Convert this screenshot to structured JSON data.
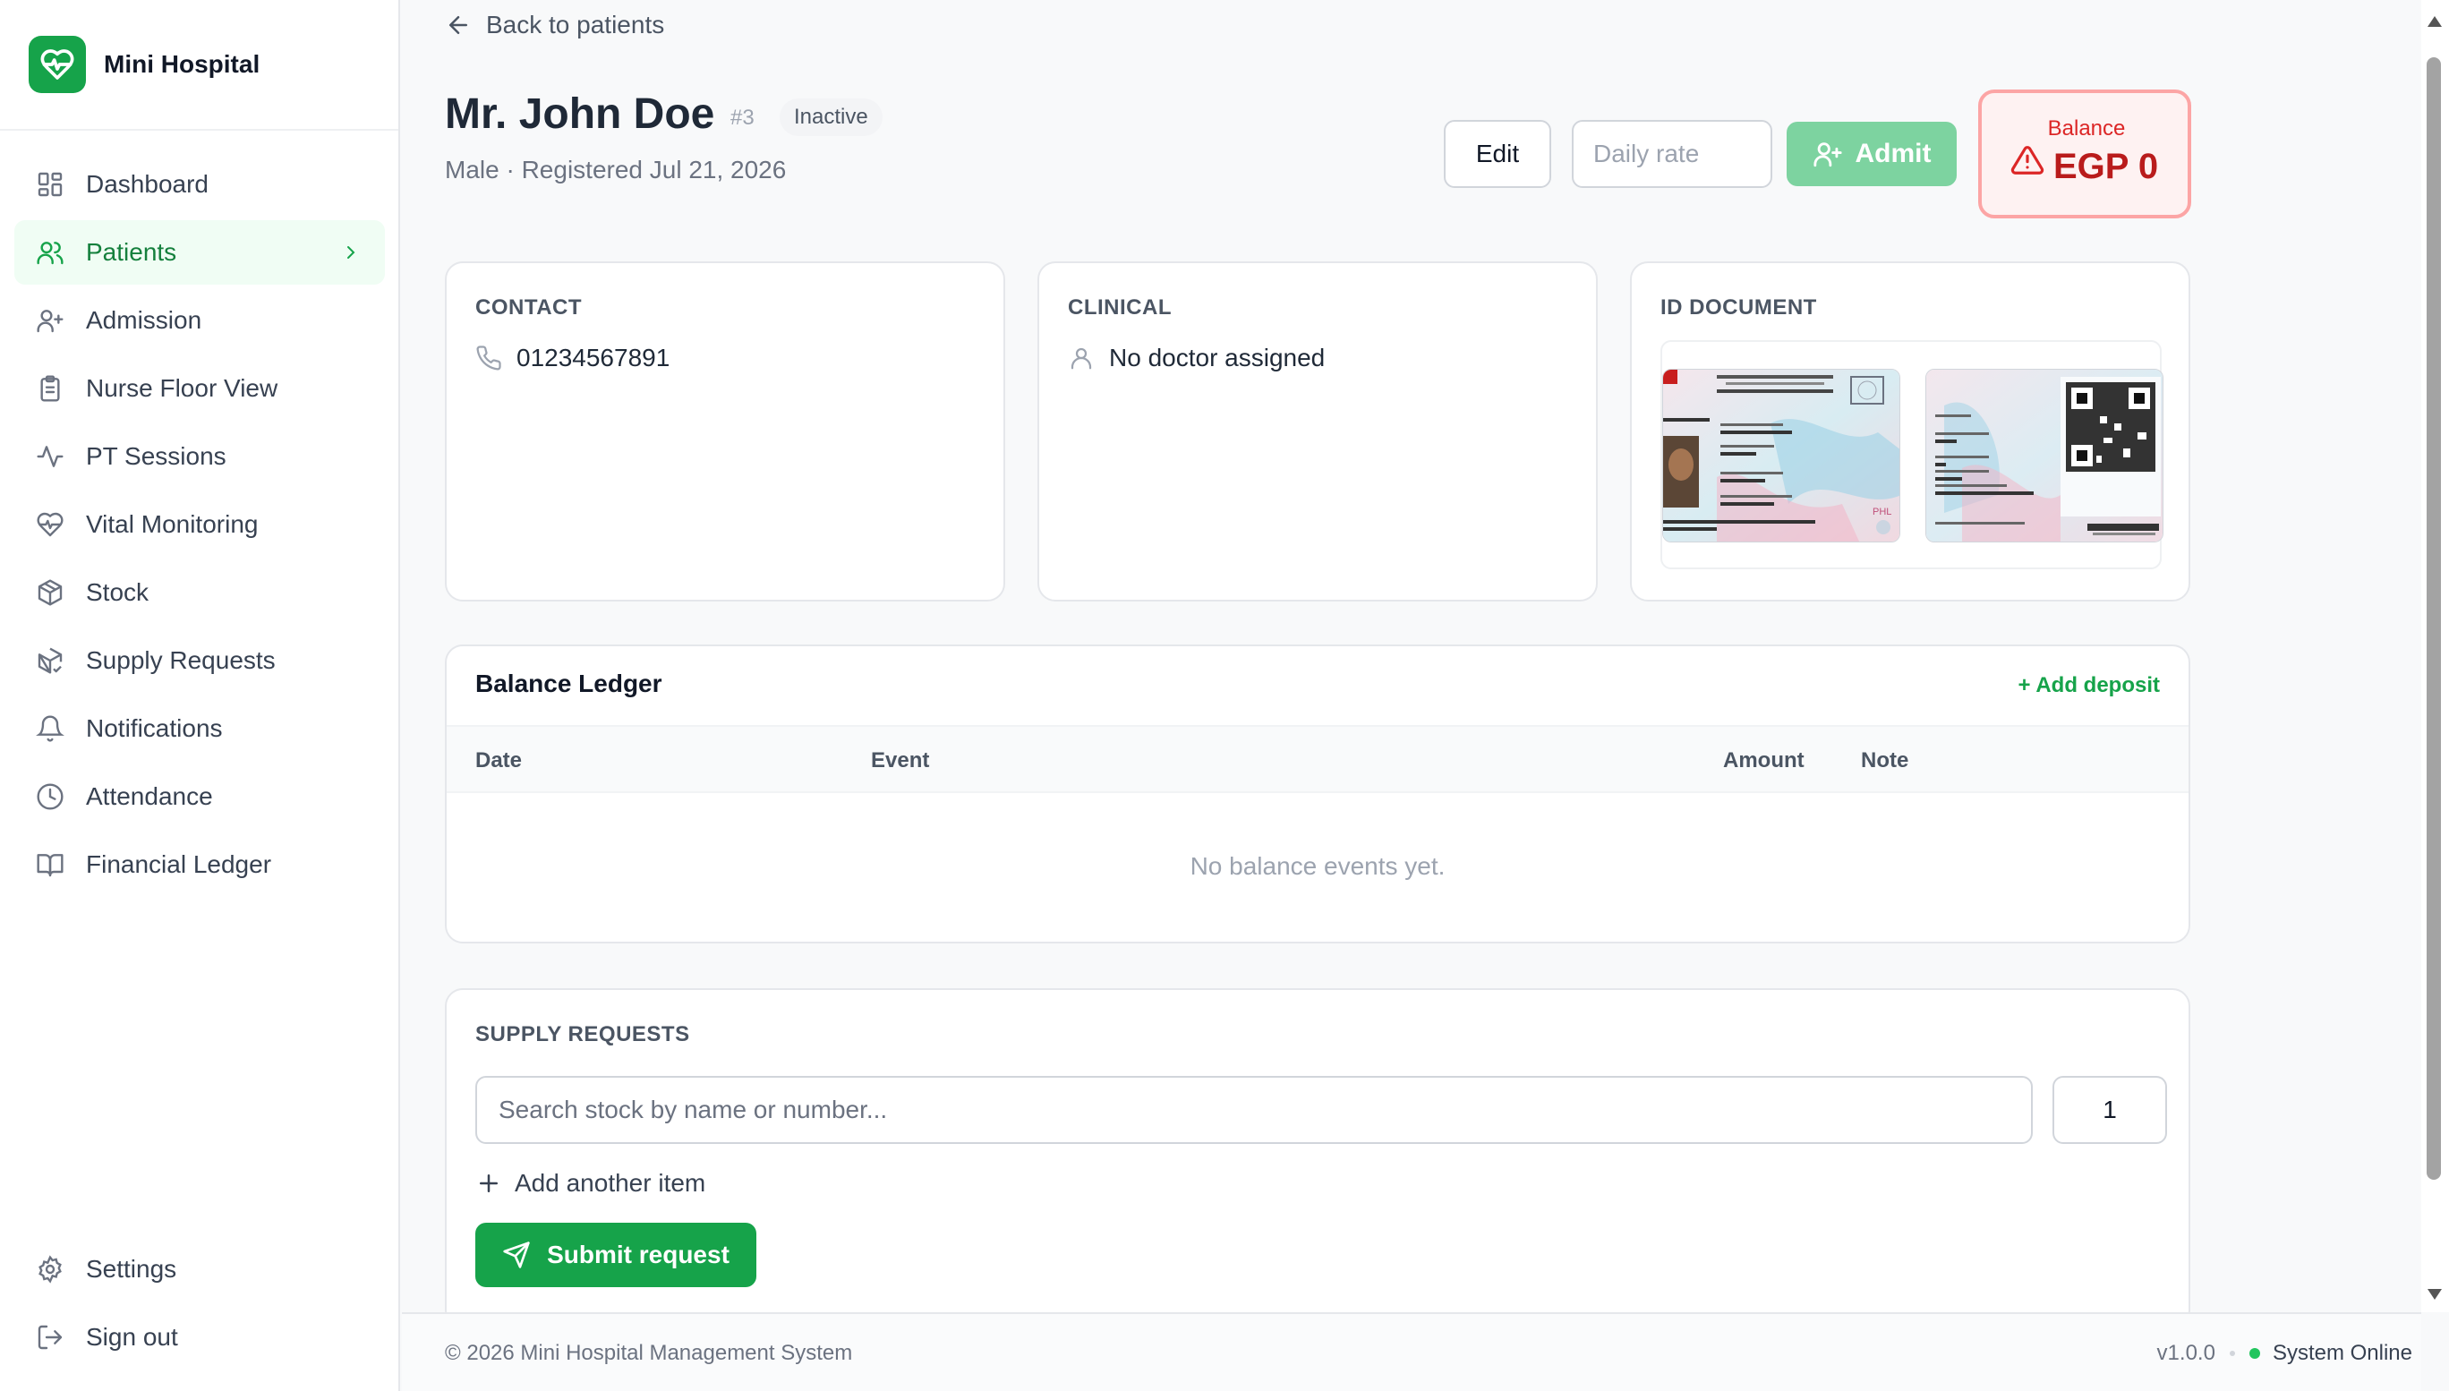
{
  "app": {
    "name": "Mini Hospital",
    "brand_color": "#16a34a"
  },
  "sidebar": {
    "items": [
      {
        "label": "Dashboard",
        "icon": "dashboard-icon"
      },
      {
        "label": "Patients",
        "icon": "users-icon",
        "active": true
      },
      {
        "label": "Admission",
        "icon": "user-plus-icon"
      },
      {
        "label": "Nurse Floor View",
        "icon": "clipboard-icon"
      },
      {
        "label": "PT Sessions",
        "icon": "activity-icon"
      },
      {
        "label": "Vital Monitoring",
        "icon": "heart-pulse-icon"
      },
      {
        "label": "Stock",
        "icon": "package-icon"
      },
      {
        "label": "Supply Requests",
        "icon": "package-check-icon"
      },
      {
        "label": "Notifications",
        "icon": "bell-icon"
      },
      {
        "label": "Attendance",
        "icon": "clock-icon"
      },
      {
        "label": "Financial Ledger",
        "icon": "book-icon"
      }
    ],
    "bottom": [
      {
        "label": "Settings",
        "icon": "gear-icon"
      },
      {
        "label": "Sign out",
        "icon": "log-out-icon"
      }
    ]
  },
  "header": {
    "back_label": "Back to patients",
    "patient_name": "Mr. John Doe",
    "patient_id": "#3",
    "status": "Inactive",
    "subtitle": "Male · Registered Jul 21, 2026",
    "edit_label": "Edit",
    "daily_rate_placeholder": "Daily rate",
    "admit_label": "Admit",
    "balance_label": "Balance",
    "balance_value": "EGP 0"
  },
  "contact": {
    "heading": "CONTACT",
    "phone": "01234567891"
  },
  "clinical": {
    "heading": "CLINICAL",
    "doctor": "No doctor assigned"
  },
  "id_document": {
    "heading": "ID DOCUMENT"
  },
  "ledger": {
    "heading": "Balance Ledger",
    "add_deposit": "+ Add deposit",
    "columns": [
      "Date",
      "Event",
      "Amount",
      "Note"
    ],
    "empty_text": "No balance events yet."
  },
  "supply": {
    "heading": "SUPPLY REQUESTS",
    "search_placeholder": "Search stock by name or number...",
    "quantity": "1",
    "add_item": "Add another item",
    "submit": "Submit request"
  },
  "footer": {
    "copyright": "© 2026 Mini Hospital Management System",
    "version": "v1.0.0",
    "status": "System Online"
  }
}
